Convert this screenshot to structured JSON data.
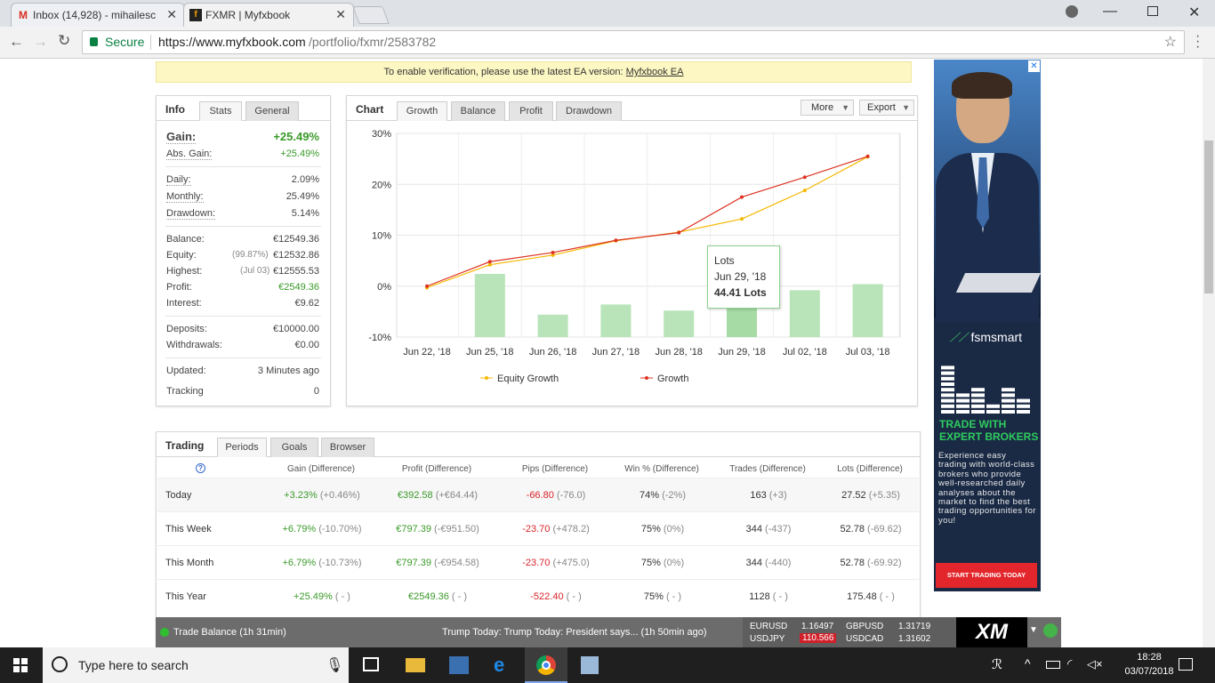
{
  "browser": {
    "tabs": [
      {
        "title": "Inbox (14,928) - mihailesc",
        "favicon": "gmail-icon"
      },
      {
        "title": "FXMR | Myfxbook",
        "favicon": "myfxbook-icon"
      }
    ],
    "secure_label": "Secure",
    "url_prefix": "https://www.myfxbook.com",
    "url_path": "/portfolio/fxmr/2583782"
  },
  "notice": {
    "text": "To enable verification, please use the latest EA version:",
    "link": "Myfxbook EA"
  },
  "info_panel": {
    "tabs": [
      "Info",
      "Stats",
      "General"
    ],
    "gain_label": "Gain:",
    "gain_value": "+25.49%",
    "abs_gain_label": "Abs. Gain:",
    "abs_gain_value": "+25.49%",
    "daily_label": "Daily:",
    "daily_value": "2.09%",
    "monthly_label": "Monthly:",
    "monthly_value": "25.49%",
    "drawdown_label": "Drawdown:",
    "drawdown_value": "5.14%",
    "balance_label": "Balance:",
    "balance_value": "€12549.36",
    "equity_label": "Equity:",
    "equity_note": "(99.87%)",
    "equity_value": "€12532.86",
    "highest_label": "Highest:",
    "highest_note": "(Jul 03)",
    "highest_value": "€12555.53",
    "profit_label": "Profit:",
    "profit_value": "€2549.36",
    "interest_label": "Interest:",
    "interest_value": "€9.62",
    "deposits_label": "Deposits:",
    "deposits_value": "€10000.00",
    "withdrawals_label": "Withdrawals:",
    "withdrawals_value": "€0.00",
    "updated_label": "Updated:",
    "updated_value": "3 Minutes ago",
    "tracking_label": "Tracking",
    "tracking_value": "0"
  },
  "chart_panel": {
    "title": "Chart",
    "tabs": [
      "Growth",
      "Balance",
      "Profit",
      "Drawdown"
    ],
    "more_label": "More",
    "export_label": "Export",
    "tooltip": {
      "title": "Lots",
      "date": "Jun 29, '18",
      "value": "44.41 Lots"
    }
  },
  "chart_data": {
    "type": "line",
    "categories": [
      "Jun 22, '18",
      "Jun 25, '18",
      "Jun 26, '18",
      "Jun 27, '18",
      "Jun 28, '18",
      "Jun 29, '18",
      "Jul 02, '18",
      "Jul 03, '18"
    ],
    "yticks": [
      "30%",
      "20%",
      "10%",
      "0%",
      "-10%"
    ],
    "ylim": [
      -10,
      30
    ],
    "series": [
      {
        "name": "Equity Growth",
        "color": "#f5b800",
        "values": [
          -0.3,
          4.2,
          6.1,
          8.9,
          10.6,
          13.2,
          18.8,
          25.4
        ]
      },
      {
        "name": "Growth",
        "color": "#dd3322",
        "values": [
          0,
          4.8,
          6.6,
          9.0,
          10.5,
          17.5,
          21.4,
          25.5
        ]
      }
    ],
    "bars": {
      "name": "Lots",
      "color": "#b9e4b9",
      "highlight_color": "#a6dba6",
      "max": 100,
      "values": [
        0,
        31,
        11,
        16,
        13,
        44.41,
        23,
        26
      ]
    }
  },
  "trading": {
    "tabs": [
      "Trading",
      "Periods",
      "Goals",
      "Browser"
    ],
    "headers": [
      "Gain (Difference)",
      "Profit (Difference)",
      "Pips (Difference)",
      "Win % (Difference)",
      "Trades (Difference)",
      "Lots (Difference)"
    ],
    "help_icon": "?",
    "rows": [
      {
        "period": "Today",
        "gain": "+3.23%",
        "gain_d": "(+0.46%)",
        "profit": "€392.58",
        "profit_d": "(+€64.44)",
        "pips": "-66.80",
        "pips_d": "(-76.0)",
        "win": "74%",
        "win_d": "(-2%)",
        "trades": "163",
        "trades_d": "(+3)",
        "lots": "27.52",
        "lots_d": "(+5.35)"
      },
      {
        "period": "This Week",
        "gain": "+6.79%",
        "gain_d": "(-10.70%)",
        "profit": "€797.39",
        "profit_d": "(-€951.50)",
        "pips": "-23.70",
        "pips_d": "(+478.2)",
        "win": "75%",
        "win_d": "(0%)",
        "trades": "344",
        "trades_d": "(-437)",
        "lots": "52.78",
        "lots_d": "(-69.62)"
      },
      {
        "period": "This Month",
        "gain": "+6.79%",
        "gain_d": "(-10.73%)",
        "profit": "€797.39",
        "profit_d": "(-€954.58)",
        "pips": "-23.70",
        "pips_d": "(+475.0)",
        "win": "75%",
        "win_d": "(0%)",
        "trades": "344",
        "trades_d": "(-440)",
        "lots": "52.78",
        "lots_d": "(-69.92)"
      },
      {
        "period": "This Year",
        "gain": "+25.49%",
        "gain_d": "( - )",
        "profit": "€2549.36",
        "profit_d": "( - )",
        "pips": "-522.40",
        "pips_d": "( - )",
        "win": "75%",
        "win_d": "( - )",
        "trades": "1128",
        "trades_d": "( - )",
        "lots": "175.48",
        "lots_d": "( - )"
      }
    ]
  },
  "ad": {
    "brand": "fsmsmart",
    "headline1": "TRADE WITH",
    "headline2": "EXPERT BROKERS",
    "body": "Experience easy trading with world-class brokers who provide well-researched daily analyses about the market to find the best trading opportunities for you!",
    "cta": "START TRADING TODAY",
    "close": "✕"
  },
  "strip": {
    "news1": "Trade Balance (1h 31min)",
    "news2": "Trump Today: Trump Today: President says...  (1h 50min ago)",
    "quotes": [
      {
        "pair": "EURUSD",
        "price": "1.16497"
      },
      {
        "pair": "GBPUSD",
        "price": "1.31719"
      },
      {
        "pair": "USDJPY",
        "price": "110.566"
      },
      {
        "pair": "USDCAD",
        "price": "1.31602"
      }
    ],
    "brand": "XM"
  },
  "taskbar": {
    "search_placeholder": "Type here to search",
    "time": "18:28",
    "date": "03/07/2018"
  }
}
